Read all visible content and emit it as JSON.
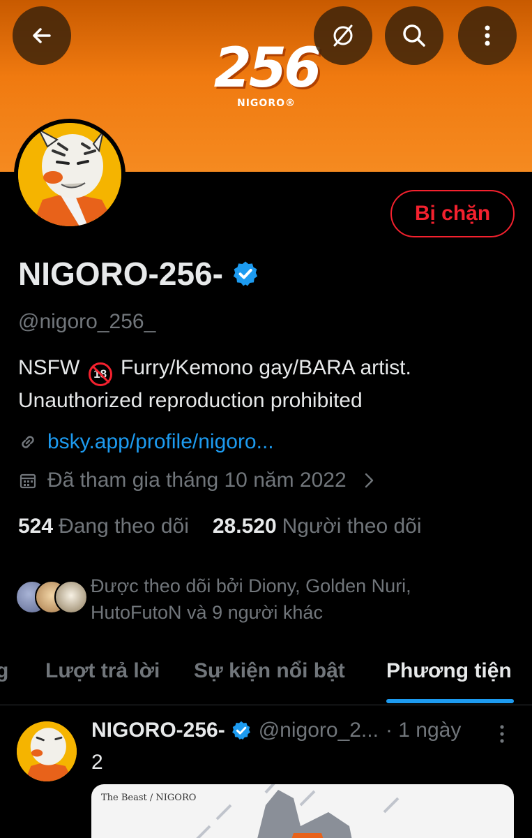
{
  "header": {
    "banner_logo_number": "256",
    "banner_logo_sub": "NIGORO®",
    "banner_color": "#f07a10"
  },
  "icons": {
    "back": "arrow-left-icon",
    "hide": "eye-slash-icon",
    "search": "search-icon",
    "more": "more-vertical-icon"
  },
  "profile": {
    "display_name": "NIGORO-256-",
    "handle": "@nigoro_256_",
    "blocked_label": "Bị chặn",
    "bio_part1": "NSFW ",
    "bio_badge": "18",
    "bio_part2": " Furry/Kemono gay/BARA artist. Unauthorized reproduction prohibited",
    "link": "bsky.app/profile/nigoro...",
    "joined": "Đã tham gia tháng 10 năm 2022",
    "following_count": "524",
    "following_label": "Đang theo dõi",
    "followers_count": "28.520",
    "followers_label": "Người theo dõi",
    "followed_by": "Được theo dõi bởi Diony, Golden Nuri, HutoFutoN và 9 người khác"
  },
  "tabs": [
    {
      "label": "g"
    },
    {
      "label": "Lượt trả lời"
    },
    {
      "label": "Sự kiện nổi bật"
    },
    {
      "label": "Phương tiện"
    }
  ],
  "post": {
    "name": "NIGORO-256-",
    "handle": "@nigoro_2...",
    "time": "· 1 ngày",
    "text": "2",
    "media_caption": "The Beast / NIGORO"
  },
  "colors": {
    "accent": "#1d9bf0",
    "blocked": "#f4212e",
    "muted": "#71767b"
  }
}
